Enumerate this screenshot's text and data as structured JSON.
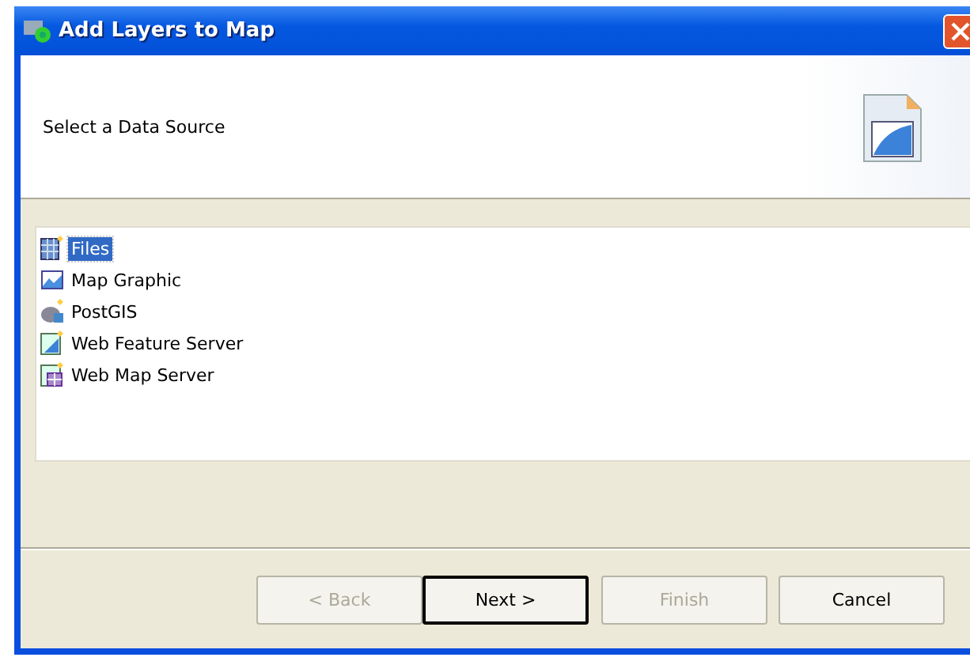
{
  "window": {
    "title": "Add Layers to Map"
  },
  "header": {
    "message": "Select a Data Source"
  },
  "sources": [
    {
      "label": "Files",
      "kind": "files",
      "selected": true
    },
    {
      "label": "Map Graphic",
      "kind": "graphic",
      "selected": false
    },
    {
      "label": "PostGIS",
      "kind": "postgis",
      "selected": false
    },
    {
      "label": "Web Feature Server",
      "kind": "wfs",
      "selected": false
    },
    {
      "label": "Web Map Server",
      "kind": "wms",
      "selected": false
    }
  ],
  "buttons": [
    {
      "label": "< Back",
      "disabled": true,
      "default": false
    },
    {
      "label": "Next >",
      "disabled": false,
      "default": true
    },
    {
      "label": "Finish",
      "disabled": true,
      "default": false
    },
    {
      "label": "Cancel",
      "disabled": false,
      "default": false
    }
  ]
}
